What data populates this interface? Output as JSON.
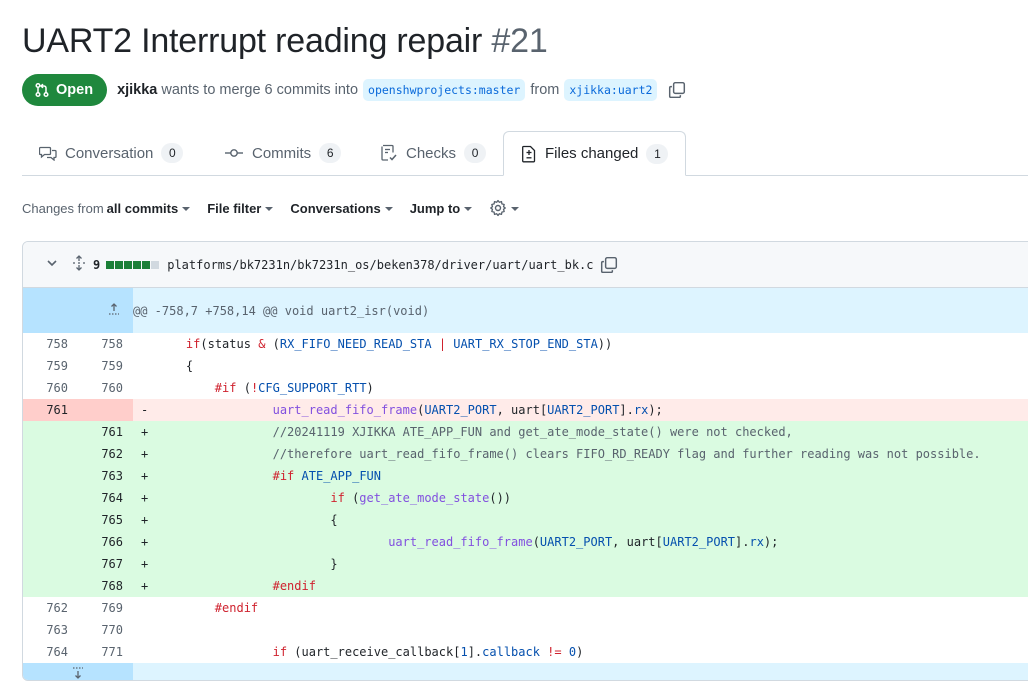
{
  "pr": {
    "title": "UART2 Interrupt reading repair",
    "number": "#21",
    "state": "Open",
    "author": "xjikka",
    "merge_text": "wants to merge 6 commits into",
    "base_branch": "openshwprojects:master",
    "from_text": "from",
    "head_branch": "xjikka:uart2"
  },
  "tabs": [
    {
      "label": "Conversation",
      "count": "0"
    },
    {
      "label": "Commits",
      "count": "6"
    },
    {
      "label": "Checks",
      "count": "0"
    },
    {
      "label": "Files changed",
      "count": "1"
    }
  ],
  "toolbar": {
    "changes_prefix": "Changes from",
    "changes_value": "all commits",
    "file_filter": "File filter",
    "conversations": "Conversations",
    "jump_to": "Jump to"
  },
  "file": {
    "changes_count": "9",
    "path": "platforms/bk7231n/bk7231n_os/beken378/driver/uart/uart_bk.c",
    "diffstat": [
      "add",
      "add",
      "add",
      "add",
      "add",
      "neutral"
    ]
  },
  "diff": {
    "hunk_header": "@@ -758,7 +758,14 @@ void uart2_isr(void)",
    "lines": [
      {
        "type": "ctx",
        "old": "758",
        "new": "758",
        "marker": "",
        "code": "    if(status & (RX_FIFO_NEED_READ_STA | UART_RX_STOP_END_STA))"
      },
      {
        "type": "ctx",
        "old": "759",
        "new": "759",
        "marker": "",
        "code": "    {"
      },
      {
        "type": "ctx",
        "old": "760",
        "new": "760",
        "marker": "",
        "code": "        #if (!CFG_SUPPORT_RTT)"
      },
      {
        "type": "del",
        "old": "761",
        "new": "",
        "marker": "-",
        "code": "                uart_read_fifo_frame(UART2_PORT, uart[UART2_PORT].rx);"
      },
      {
        "type": "add",
        "old": "",
        "new": "761",
        "marker": "+",
        "code": "                //20241119 XJIKKA ATE_APP_FUN and get_ate_mode_state() were not checked,"
      },
      {
        "type": "add",
        "old": "",
        "new": "762",
        "marker": "+",
        "code": "                //therefore uart_read_fifo_frame() clears FIFO_RD_READY flag and further reading was not possible."
      },
      {
        "type": "add",
        "old": "",
        "new": "763",
        "marker": "+",
        "code": "                #if ATE_APP_FUN"
      },
      {
        "type": "add",
        "old": "",
        "new": "764",
        "marker": "+",
        "code": "                        if (get_ate_mode_state())"
      },
      {
        "type": "add",
        "old": "",
        "new": "765",
        "marker": "+",
        "code": "                        {"
      },
      {
        "type": "add",
        "old": "",
        "new": "766",
        "marker": "+",
        "code": "                                uart_read_fifo_frame(UART2_PORT, uart[UART2_PORT].rx);"
      },
      {
        "type": "add",
        "old": "",
        "new": "767",
        "marker": "+",
        "code": "                        }"
      },
      {
        "type": "add",
        "old": "",
        "new": "768",
        "marker": "+",
        "code": "                #endif"
      },
      {
        "type": "ctx",
        "old": "762",
        "new": "769",
        "marker": "",
        "code": "        #endif"
      },
      {
        "type": "ctx",
        "old": "763",
        "new": "770",
        "marker": "",
        "code": ""
      },
      {
        "type": "ctx",
        "old": "764",
        "new": "771",
        "marker": "",
        "code": "                if (uart_receive_callback[1].callback != 0)"
      }
    ]
  },
  "colors": {
    "open_green": "#1f883d",
    "add_bg": "#dafbe1",
    "del_bg": "#ffebe9",
    "hunk_bg": "#ddf4ff",
    "link_blue": "#0969da"
  },
  "icons": {
    "state": "git-pull-request-icon",
    "copy": "copy-icon",
    "conversation": "comment-discussion-icon",
    "commits": "git-commit-icon",
    "checks": "checklist-icon",
    "files": "file-diff-icon",
    "settings": "gear-icon",
    "collapse": "chevron-down-icon",
    "expand": "unfold-icon",
    "expand_up": "expand-up-icon",
    "expand_down": "expand-down-icon"
  }
}
